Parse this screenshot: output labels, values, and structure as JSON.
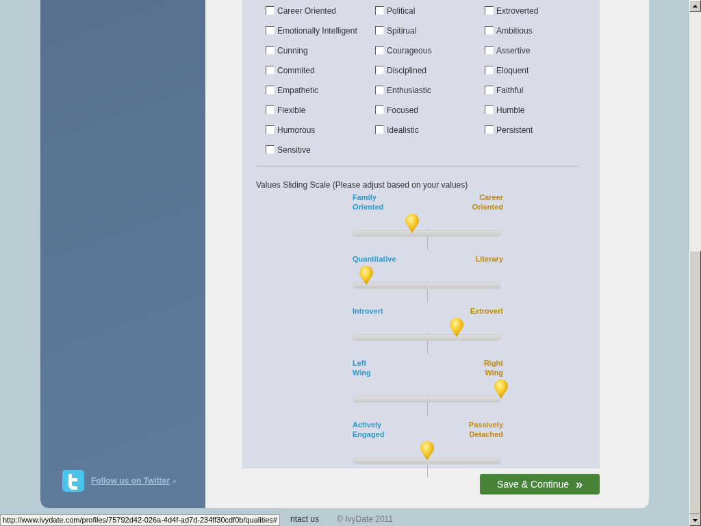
{
  "qualities": [
    {
      "label": "Career Oriented",
      "checked": false
    },
    {
      "label": "Political",
      "checked": false
    },
    {
      "label": "Extroverted",
      "checked": false
    },
    {
      "label": "Emotionally Intelligent",
      "checked": false
    },
    {
      "label": "Spitirual",
      "checked": false
    },
    {
      "label": "Ambitious",
      "checked": false
    },
    {
      "label": "Cunning",
      "checked": false
    },
    {
      "label": "Courageous",
      "checked": false
    },
    {
      "label": "Assertive",
      "checked": false
    },
    {
      "label": "Commited",
      "checked": false
    },
    {
      "label": "Disciplined",
      "checked": false
    },
    {
      "label": "Eloquent",
      "checked": false
    },
    {
      "label": "Empathetic",
      "checked": false
    },
    {
      "label": "Enthusiastic",
      "checked": false
    },
    {
      "label": "Faithful",
      "checked": false
    },
    {
      "label": "Flexible",
      "checked": false
    },
    {
      "label": "Focused",
      "checked": false
    },
    {
      "label": "Humble",
      "checked": false
    },
    {
      "label": "Humorous",
      "checked": false
    },
    {
      "label": "Idealistic",
      "checked": false
    },
    {
      "label": "Persistent",
      "checked": false
    },
    {
      "label": "Sensitive",
      "checked": false
    }
  ],
  "values_title": "Values Sliding Scale (Please adjust based on your values)",
  "sliders": [
    {
      "left": "Family\nOriented",
      "right": "Career\nOriented",
      "level": 0.4
    },
    {
      "left": "Quantitative",
      "right": "Literary",
      "level": 0.09
    },
    {
      "left": "Introvert",
      "right": "Extrovert",
      "level": 0.7
    },
    {
      "left": "Left\nWing",
      "right": "Right\nWing",
      "level": 1.0
    },
    {
      "left": "Actively\nEngaged",
      "right": "Passively\nDetached",
      "level": 0.5
    }
  ],
  "sidebar": {
    "twitter_link": "Follow us on Twitter",
    "twitter_arrow": "»"
  },
  "save_button": {
    "label": "Save & Continue",
    "icon": "»"
  },
  "footer": {
    "link": "ntact us",
    "copyright": "© IvyDate 2011"
  },
  "status_bar": {
    "url": "http://www.ivydate.com/profiles/75792d42-026a-4d4f-ad7d-234ff30cdf0b/qualities#"
  }
}
